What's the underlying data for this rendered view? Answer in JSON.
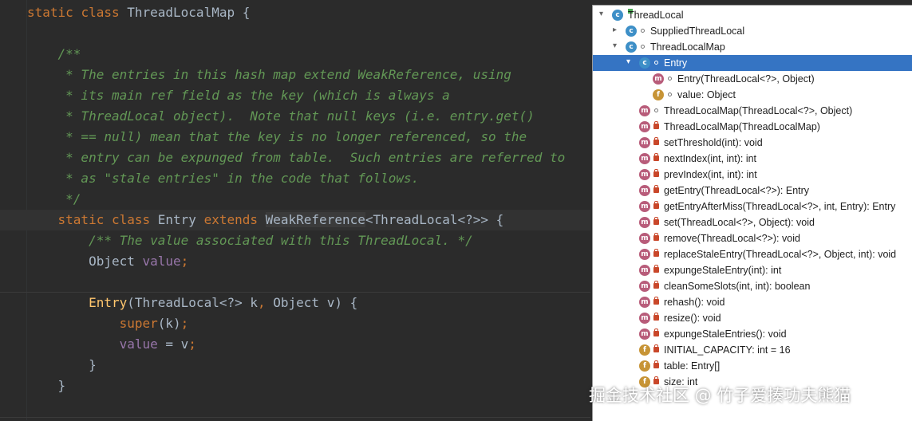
{
  "editor": {
    "lines": [
      [
        {
          "t": "static ",
          "c": "kw"
        },
        {
          "t": "class ",
          "c": "kw"
        },
        {
          "t": "ThreadLocalMap {",
          "c": ""
        }
      ],
      [],
      [
        {
          "t": "    /**",
          "c": "doc"
        }
      ],
      [
        {
          "t": "     * The entries in this hash map extend WeakReference, using",
          "c": "doc"
        }
      ],
      [
        {
          "t": "     * its main ref field as the key (which is always a",
          "c": "doc"
        }
      ],
      [
        {
          "t": "     * ThreadLocal object).  Note that null keys (i.e. entry.get()",
          "c": "doc"
        }
      ],
      [
        {
          "t": "     * == null) mean that the key is no longer referenced, so the",
          "c": "doc"
        }
      ],
      [
        {
          "t": "     * entry can be expunged from table.  Such entries are referred to",
          "c": "doc"
        }
      ],
      [
        {
          "t": "     * as \"stale entries\" in the code that follows.",
          "c": "doc"
        }
      ],
      [
        {
          "t": "     */",
          "c": "doc"
        }
      ],
      [
        {
          "t": "    static ",
          "c": "kw"
        },
        {
          "t": "class ",
          "c": "kw"
        },
        {
          "t": "Entry ",
          "c": ""
        },
        {
          "t": "extends ",
          "c": "kw"
        },
        {
          "t": "WeakReference",
          "c": "hl"
        },
        {
          "t": "<ThreadLocal<?>> {",
          "c": ""
        }
      ],
      [
        {
          "t": "        /** The value associated with this ThreadLocal. */",
          "c": "doc"
        }
      ],
      [
        {
          "t": "        Object ",
          "c": ""
        },
        {
          "t": "value",
          "c": "fld"
        },
        {
          "t": ";",
          "c": "kw"
        }
      ],
      [],
      [
        {
          "t": "        ",
          "c": ""
        },
        {
          "t": "Entry",
          "c": "fn"
        },
        {
          "t": "(ThreadLocal<?> k",
          "c": ""
        },
        {
          "t": ", ",
          "c": "kw"
        },
        {
          "t": "Object v) {",
          "c": ""
        }
      ],
      [
        {
          "t": "            ",
          "c": ""
        },
        {
          "t": "super",
          "c": "kw"
        },
        {
          "t": "(k)",
          "c": ""
        },
        {
          "t": ";",
          "c": "kw"
        }
      ],
      [
        {
          "t": "            ",
          "c": ""
        },
        {
          "t": "value",
          "c": "fld"
        },
        {
          "t": " = v",
          "c": ""
        },
        {
          "t": ";",
          "c": "kw"
        }
      ],
      [
        {
          "t": "        }",
          "c": ""
        }
      ],
      [
        {
          "t": "    }",
          "c": ""
        }
      ]
    ]
  },
  "structure": {
    "items": [
      {
        "label": "ThreadLocal",
        "indent": 0,
        "chev": "down",
        "icon": "c",
        "lock": false,
        "dot": false,
        "tag": true,
        "selected": false
      },
      {
        "label": "SuppliedThreadLocal",
        "indent": 1,
        "chev": "right",
        "icon": "c",
        "lock": false,
        "dot": true,
        "tag": false,
        "selected": false
      },
      {
        "label": "ThreadLocalMap",
        "indent": 1,
        "chev": "down",
        "icon": "c",
        "lock": false,
        "dot": true,
        "tag": false,
        "selected": false
      },
      {
        "label": "Entry",
        "indent": 2,
        "chev": "down",
        "icon": "c",
        "lock": false,
        "dot": true,
        "tag": false,
        "selected": true
      },
      {
        "label": "Entry(ThreadLocal<?>, Object)",
        "indent": 3,
        "chev": "",
        "icon": "m",
        "lock": false,
        "dot": true,
        "tag": false,
        "selected": false
      },
      {
        "label": "value: Object",
        "indent": 3,
        "chev": "",
        "icon": "f",
        "lock": false,
        "dot": true,
        "tag": false,
        "selected": false
      },
      {
        "label": "ThreadLocalMap(ThreadLocal<?>, Object)",
        "indent": 2,
        "chev": "",
        "icon": "m",
        "lock": false,
        "dot": true,
        "tag": false,
        "selected": false
      },
      {
        "label": "ThreadLocalMap(ThreadLocalMap)",
        "indent": 2,
        "chev": "",
        "icon": "m",
        "lock": true,
        "dot": false,
        "tag": false,
        "selected": false
      },
      {
        "label": "setThreshold(int): void",
        "indent": 2,
        "chev": "",
        "icon": "m",
        "lock": true,
        "dot": false,
        "tag": false,
        "selected": false
      },
      {
        "label": "nextIndex(int, int): int",
        "indent": 2,
        "chev": "",
        "icon": "m",
        "lock": true,
        "dot": false,
        "tag": false,
        "selected": false
      },
      {
        "label": "prevIndex(int, int): int",
        "indent": 2,
        "chev": "",
        "icon": "m",
        "lock": true,
        "dot": false,
        "tag": false,
        "selected": false
      },
      {
        "label": "getEntry(ThreadLocal<?>): Entry",
        "indent": 2,
        "chev": "",
        "icon": "m",
        "lock": true,
        "dot": false,
        "tag": false,
        "selected": false
      },
      {
        "label": "getEntryAfterMiss(ThreadLocal<?>, int, Entry): Entry",
        "indent": 2,
        "chev": "",
        "icon": "m",
        "lock": true,
        "dot": false,
        "tag": false,
        "selected": false
      },
      {
        "label": "set(ThreadLocal<?>, Object): void",
        "indent": 2,
        "chev": "",
        "icon": "m",
        "lock": true,
        "dot": false,
        "tag": false,
        "selected": false
      },
      {
        "label": "remove(ThreadLocal<?>): void",
        "indent": 2,
        "chev": "",
        "icon": "m",
        "lock": true,
        "dot": false,
        "tag": false,
        "selected": false
      },
      {
        "label": "replaceStaleEntry(ThreadLocal<?>, Object, int): void",
        "indent": 2,
        "chev": "",
        "icon": "m",
        "lock": true,
        "dot": false,
        "tag": false,
        "selected": false
      },
      {
        "label": "expungeStaleEntry(int): int",
        "indent": 2,
        "chev": "",
        "icon": "m",
        "lock": true,
        "dot": false,
        "tag": false,
        "selected": false
      },
      {
        "label": "cleanSomeSlots(int, int): boolean",
        "indent": 2,
        "chev": "",
        "icon": "m",
        "lock": true,
        "dot": false,
        "tag": false,
        "selected": false
      },
      {
        "label": "rehash(): void",
        "indent": 2,
        "chev": "",
        "icon": "m",
        "lock": true,
        "dot": false,
        "tag": false,
        "selected": false
      },
      {
        "label": "resize(): void",
        "indent": 2,
        "chev": "",
        "icon": "m",
        "lock": true,
        "dot": false,
        "tag": false,
        "selected": false
      },
      {
        "label": "expungeStaleEntries(): void",
        "indent": 2,
        "chev": "",
        "icon": "m",
        "lock": true,
        "dot": false,
        "tag": false,
        "selected": false
      },
      {
        "label": "INITIAL_CAPACITY: int = 16",
        "indent": 2,
        "chev": "",
        "icon": "f",
        "lock": true,
        "dot": false,
        "tag": false,
        "selected": false
      },
      {
        "label": "table: Entry[]",
        "indent": 2,
        "chev": "",
        "icon": "f",
        "lock": true,
        "dot": false,
        "tag": false,
        "selected": false
      },
      {
        "label": "size: int",
        "indent": 2,
        "chev": "",
        "icon": "f",
        "lock": true,
        "dot": false,
        "tag": false,
        "selected": false
      }
    ]
  },
  "watermark": "掘金技术社区 @ 竹子爱揍功夫熊猫"
}
